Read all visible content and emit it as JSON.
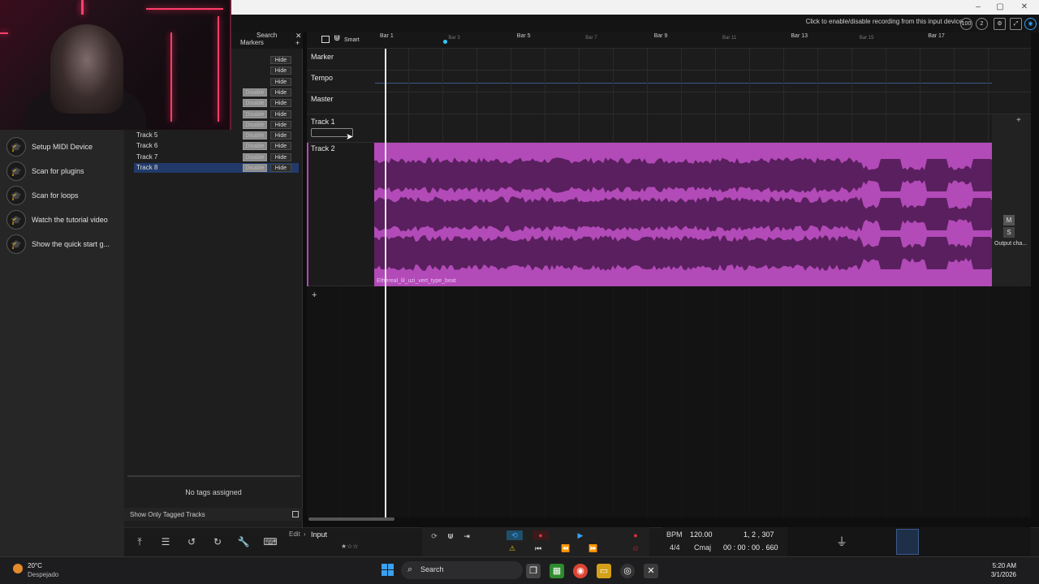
{
  "colors": {
    "accent_purple": "#b24ab8",
    "waveform": "#5a1f5e",
    "track_selected": "#213a6a",
    "record_red": "#e0313e",
    "play_blue": "#36a3ff"
  },
  "topbar": {
    "record_hint": "Click to enable/disable recording from this input device",
    "input_level": "100",
    "input_channel": "2"
  },
  "tracks_panel": {
    "search_label": "Search",
    "markers_label": "Markers",
    "rows": [
      {
        "name": "",
        "disable": "",
        "hide": "Hide"
      },
      {
        "name": "",
        "disable": "",
        "hide": "Hide"
      },
      {
        "name": "",
        "disable": "",
        "hide": "Hide"
      },
      {
        "name": "",
        "disable": "Disable",
        "hide": "Hide"
      },
      {
        "name": "",
        "disable": "Disable",
        "hide": "Hide"
      },
      {
        "name": "",
        "disable": "Disable",
        "hide": "Hide"
      },
      {
        "name": "",
        "disable": "Disable",
        "hide": "Hide"
      },
      {
        "name": "Track 5",
        "disable": "Disable",
        "hide": "Hide"
      },
      {
        "name": "Track 6",
        "disable": "Disable",
        "hide": "Hide"
      },
      {
        "name": "Track 7",
        "disable": "Disable",
        "hide": "Hide"
      },
      {
        "name": "Track 8",
        "disable": "Disable",
        "hide": "Hide"
      }
    ],
    "no_tags": "No tags assigned",
    "show_only_tagged": "Show Only Tagged Tracks"
  },
  "help_panel": {
    "items": [
      {
        "label": "Setup MIDI Device",
        "icon": "graduation-cap-icon"
      },
      {
        "label": "Scan for plugins",
        "icon": "graduation-cap-icon"
      },
      {
        "label": "Scan for loops",
        "icon": "graduation-cap-icon"
      },
      {
        "label": "Watch the tutorial video",
        "icon": "graduation-cap-icon"
      },
      {
        "label": "Show the quick start g...",
        "icon": "graduation-cap-icon"
      }
    ]
  },
  "ruler": {
    "smart": "Smart",
    "bars": [
      {
        "label": "Bar 1",
        "major": true
      },
      {
        "label": "Bar 3",
        "major": false
      },
      {
        "label": "Bar 5",
        "major": true
      },
      {
        "label": "Bar 7",
        "major": false
      },
      {
        "label": "Bar 9",
        "major": true
      },
      {
        "label": "Bar 11",
        "major": false
      },
      {
        "label": "Bar 13",
        "major": true
      },
      {
        "label": "Bar 15",
        "major": false
      },
      {
        "label": "Bar 17",
        "major": true
      }
    ]
  },
  "lanes": {
    "marker": "Marker",
    "tempo": "Tempo",
    "master": "Master",
    "track1": "Track 1",
    "track2": "Track 2",
    "clip_name": "Ethereal_lil_uzi_vert_type_beat",
    "output": "Output cha...",
    "mute": "M",
    "solo": "S"
  },
  "bottom": {
    "edit": "Edit",
    "input": "Input",
    "bpm_label": "BPM",
    "bpm_value": "120.00",
    "position": "1, 2 , 307",
    "time_sig": "4/4",
    "key": "Cmaj",
    "timecode": "00 : 00 : 00 . 660"
  },
  "taskbar": {
    "weather_temp": "20°C",
    "weather_desc": "Despejado",
    "search": "Search",
    "time": "5:20 AM",
    "date": "3/1/2026"
  }
}
